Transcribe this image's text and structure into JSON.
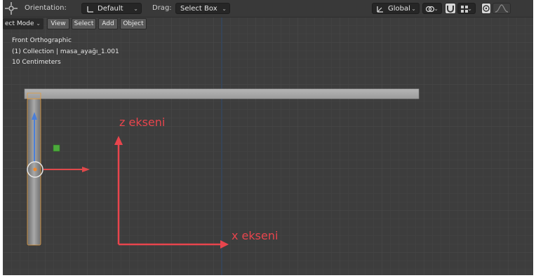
{
  "header": {
    "orientation_label": "Orientation:",
    "orientation_value": "Default",
    "drag_label": "Drag:",
    "drag_value": "Select Box",
    "transform_space": "Global"
  },
  "modebar": {
    "mode": "ect Mode",
    "menus": [
      "View",
      "Select",
      "Add",
      "Object"
    ]
  },
  "viewport": {
    "view_name": "Front Orthographic",
    "collection": "(1) Collection | masa_ayağı_1.001",
    "scale": "10 Centimeters",
    "z_axis_label": "z ekseni",
    "x_axis_label": "x ekseni",
    "colors": {
      "background": "#3d3d3d",
      "axis_annotation": "#e8454d",
      "gizmo_blue": "#4a7fd9",
      "gizmo_red": "#e0484a",
      "gizmo_green": "#4caa3c",
      "vertical_axis_line": "#35465e"
    }
  },
  "icons": [
    "transform-gizmo-icon",
    "pivot-icon",
    "snap-icon",
    "proportional-edit-icon",
    "falloff-icon"
  ]
}
